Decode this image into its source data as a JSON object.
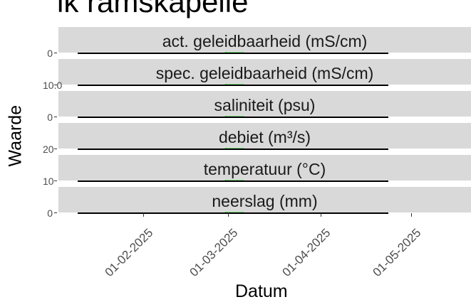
{
  "title": "lk ramskapelle",
  "chart_data": {
    "type": "line",
    "xlabel": "Datum",
    "ylabel": "Waarde",
    "x_ticks": [
      "01-02-2025",
      "01-03-2025",
      "01-04-2025",
      "01-05-2025"
    ],
    "facets": [
      {
        "label": "act. geleidbaarheid (mS/cm)",
        "y_tick": "0"
      },
      {
        "label": "spec. geleidbaarheid (mS/cm)",
        "y_tick": "10.0"
      },
      {
        "label": "saliniteit (psu)",
        "y_tick": "0"
      },
      {
        "label": "debiet (m³/s)",
        "y_tick": "20"
      },
      {
        "label": "temperatuur (°C)",
        "y_tick": "10"
      },
      {
        "label": "neerslag (mm)",
        "y_tick": "0"
      }
    ],
    "series_color": "#22dd22"
  }
}
